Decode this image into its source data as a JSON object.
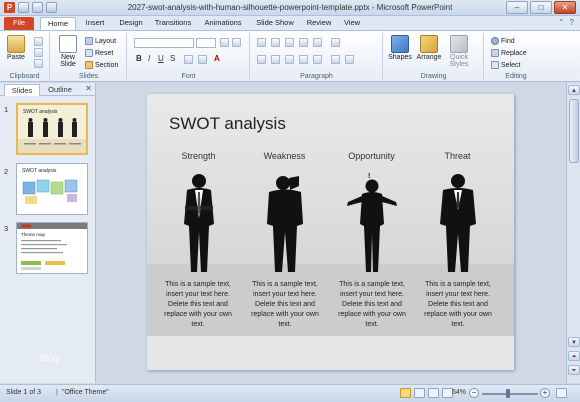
{
  "window": {
    "title": "2027-swot-analysis-with-human-silhouette-powerpoint-template.pptx - Microsoft PowerPoint",
    "app_icon_letter": "P",
    "controls": [
      "–",
      "□",
      "✕"
    ]
  },
  "ribbon_tabs": [
    "File",
    "Home",
    "Insert",
    "Design",
    "Transitions",
    "Animations",
    "Slide Show",
    "Review",
    "View"
  ],
  "ribbon": {
    "clipboard": {
      "label": "Clipboard",
      "paste": "Paste"
    },
    "slides": {
      "label": "Slides",
      "new_slide": "New Slide",
      "layout": "Layout",
      "reset": "Reset",
      "section": "Section"
    },
    "font": {
      "label": "Font"
    },
    "paragraph": {
      "label": "Paragraph"
    },
    "drawing": {
      "label": "Drawing",
      "shapes": "Shapes",
      "arrange": "Arrange",
      "quick_styles": "Quick Styles"
    },
    "editing": {
      "label": "Editing",
      "find": "Find",
      "replace": "Replace",
      "select": "Select"
    }
  },
  "left_panel": {
    "tabs": [
      "Slides",
      "Outline"
    ],
    "close": "✕",
    "thumbnails": [
      "1",
      "2",
      "3"
    ],
    "watermark": "blog",
    "thumb1_title": "SWOT analysis",
    "thumb2_title": "SWOT analysis",
    "thumb3_title": "Theme map"
  },
  "slide": {
    "title": "SWOT analysis",
    "columns": [
      {
        "heading": "Strength",
        "text": "This is a sample text, insert your text here. Delete this text and replace with your own text."
      },
      {
        "heading": "Weakness",
        "text": "This is a sample text, insert your text here. Delete this text and replace with your own text."
      },
      {
        "heading": "Opportunity",
        "text": "This is a sample text, insert your text here. Delete this text and replace with your own text."
      },
      {
        "heading": "Threat",
        "text": "This is a sample text, insert your text here. Delete this text and replace with your own text."
      }
    ]
  },
  "status": {
    "slide_info": "Slide 1 of 3",
    "theme": "\"Office Theme\"",
    "zoom": "64%",
    "zoom_minus": "−",
    "zoom_plus": "+"
  },
  "colors": {
    "file_tab": "#d24726",
    "ribbon_bg": "#e6edf6",
    "selected_thumb": "#e9b84f"
  }
}
